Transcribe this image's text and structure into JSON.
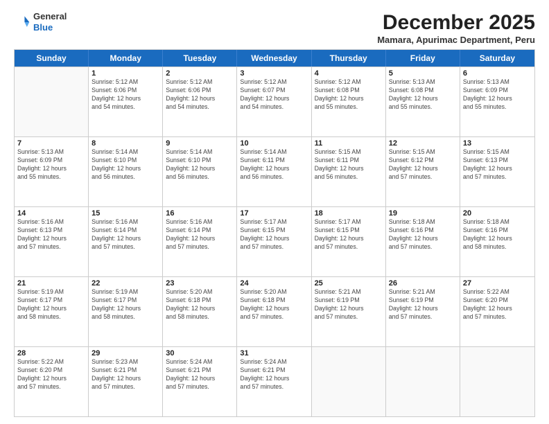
{
  "logo": {
    "general": "General",
    "blue": "Blue"
  },
  "title": "December 2025",
  "location": "Mamara, Apurimac Department, Peru",
  "days_of_week": [
    "Sunday",
    "Monday",
    "Tuesday",
    "Wednesday",
    "Thursday",
    "Friday",
    "Saturday"
  ],
  "weeks": [
    [
      {
        "day": "",
        "info": ""
      },
      {
        "day": "1",
        "info": "Sunrise: 5:12 AM\nSunset: 6:06 PM\nDaylight: 12 hours\nand 54 minutes."
      },
      {
        "day": "2",
        "info": "Sunrise: 5:12 AM\nSunset: 6:06 PM\nDaylight: 12 hours\nand 54 minutes."
      },
      {
        "day": "3",
        "info": "Sunrise: 5:12 AM\nSunset: 6:07 PM\nDaylight: 12 hours\nand 54 minutes."
      },
      {
        "day": "4",
        "info": "Sunrise: 5:12 AM\nSunset: 6:08 PM\nDaylight: 12 hours\nand 55 minutes."
      },
      {
        "day": "5",
        "info": "Sunrise: 5:13 AM\nSunset: 6:08 PM\nDaylight: 12 hours\nand 55 minutes."
      },
      {
        "day": "6",
        "info": "Sunrise: 5:13 AM\nSunset: 6:09 PM\nDaylight: 12 hours\nand 55 minutes."
      }
    ],
    [
      {
        "day": "7",
        "info": "Sunrise: 5:13 AM\nSunset: 6:09 PM\nDaylight: 12 hours\nand 55 minutes."
      },
      {
        "day": "8",
        "info": "Sunrise: 5:14 AM\nSunset: 6:10 PM\nDaylight: 12 hours\nand 56 minutes."
      },
      {
        "day": "9",
        "info": "Sunrise: 5:14 AM\nSunset: 6:10 PM\nDaylight: 12 hours\nand 56 minutes."
      },
      {
        "day": "10",
        "info": "Sunrise: 5:14 AM\nSunset: 6:11 PM\nDaylight: 12 hours\nand 56 minutes."
      },
      {
        "day": "11",
        "info": "Sunrise: 5:15 AM\nSunset: 6:11 PM\nDaylight: 12 hours\nand 56 minutes."
      },
      {
        "day": "12",
        "info": "Sunrise: 5:15 AM\nSunset: 6:12 PM\nDaylight: 12 hours\nand 57 minutes."
      },
      {
        "day": "13",
        "info": "Sunrise: 5:15 AM\nSunset: 6:13 PM\nDaylight: 12 hours\nand 57 minutes."
      }
    ],
    [
      {
        "day": "14",
        "info": "Sunrise: 5:16 AM\nSunset: 6:13 PM\nDaylight: 12 hours\nand 57 minutes."
      },
      {
        "day": "15",
        "info": "Sunrise: 5:16 AM\nSunset: 6:14 PM\nDaylight: 12 hours\nand 57 minutes."
      },
      {
        "day": "16",
        "info": "Sunrise: 5:16 AM\nSunset: 6:14 PM\nDaylight: 12 hours\nand 57 minutes."
      },
      {
        "day": "17",
        "info": "Sunrise: 5:17 AM\nSunset: 6:15 PM\nDaylight: 12 hours\nand 57 minutes."
      },
      {
        "day": "18",
        "info": "Sunrise: 5:17 AM\nSunset: 6:15 PM\nDaylight: 12 hours\nand 57 minutes."
      },
      {
        "day": "19",
        "info": "Sunrise: 5:18 AM\nSunset: 6:16 PM\nDaylight: 12 hours\nand 57 minutes."
      },
      {
        "day": "20",
        "info": "Sunrise: 5:18 AM\nSunset: 6:16 PM\nDaylight: 12 hours\nand 58 minutes."
      }
    ],
    [
      {
        "day": "21",
        "info": "Sunrise: 5:19 AM\nSunset: 6:17 PM\nDaylight: 12 hours\nand 58 minutes."
      },
      {
        "day": "22",
        "info": "Sunrise: 5:19 AM\nSunset: 6:17 PM\nDaylight: 12 hours\nand 58 minutes."
      },
      {
        "day": "23",
        "info": "Sunrise: 5:20 AM\nSunset: 6:18 PM\nDaylight: 12 hours\nand 58 minutes."
      },
      {
        "day": "24",
        "info": "Sunrise: 5:20 AM\nSunset: 6:18 PM\nDaylight: 12 hours\nand 57 minutes."
      },
      {
        "day": "25",
        "info": "Sunrise: 5:21 AM\nSunset: 6:19 PM\nDaylight: 12 hours\nand 57 minutes."
      },
      {
        "day": "26",
        "info": "Sunrise: 5:21 AM\nSunset: 6:19 PM\nDaylight: 12 hours\nand 57 minutes."
      },
      {
        "day": "27",
        "info": "Sunrise: 5:22 AM\nSunset: 6:20 PM\nDaylight: 12 hours\nand 57 minutes."
      }
    ],
    [
      {
        "day": "28",
        "info": "Sunrise: 5:22 AM\nSunset: 6:20 PM\nDaylight: 12 hours\nand 57 minutes."
      },
      {
        "day": "29",
        "info": "Sunrise: 5:23 AM\nSunset: 6:21 PM\nDaylight: 12 hours\nand 57 minutes."
      },
      {
        "day": "30",
        "info": "Sunrise: 5:24 AM\nSunset: 6:21 PM\nDaylight: 12 hours\nand 57 minutes."
      },
      {
        "day": "31",
        "info": "Sunrise: 5:24 AM\nSunset: 6:21 PM\nDaylight: 12 hours\nand 57 minutes."
      },
      {
        "day": "",
        "info": ""
      },
      {
        "day": "",
        "info": ""
      },
      {
        "day": "",
        "info": ""
      }
    ]
  ]
}
